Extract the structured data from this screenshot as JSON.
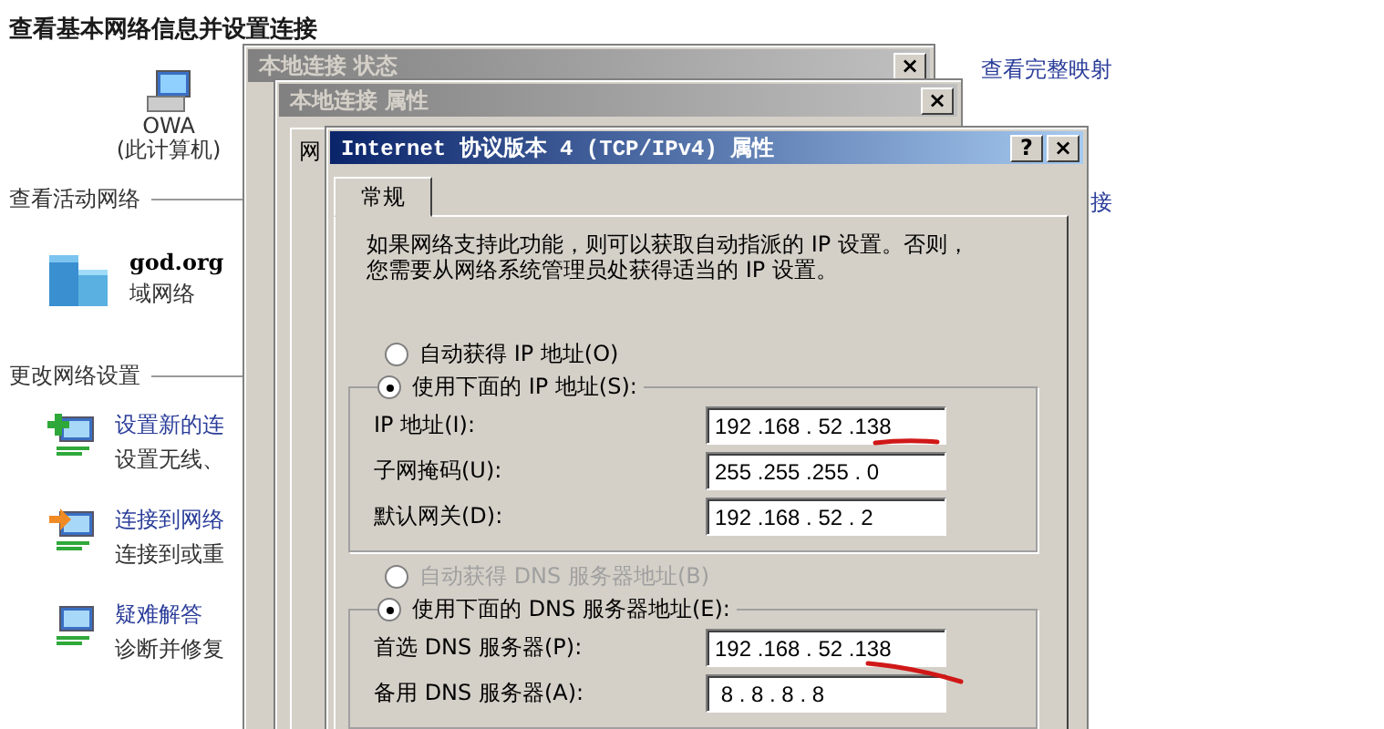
{
  "network_center": {
    "title": "查看基本网络信息并设置连接",
    "computer": {
      "name": "OWA",
      "label": "(此计算机)"
    },
    "active_networks": {
      "heading": "查看活动网络",
      "network": {
        "name": "god.org",
        "type": "域网络"
      }
    },
    "change_settings": {
      "heading": "更改网络设置",
      "tasks": [
        {
          "kind": "setup",
          "title": "设置新的连",
          "description": "设置无线、"
        },
        {
          "kind": "connect",
          "title": "连接到网络",
          "description": "连接到或重"
        },
        {
          "kind": "troubleshoot",
          "title": "疑难解答",
          "description": "诊断并修复"
        }
      ]
    },
    "links": [
      "查看完整映射",
      "接"
    ]
  },
  "status_window": {
    "title": "本地连接 状态",
    "active": false,
    "close": "×"
  },
  "properties_window": {
    "title": "本地连接 属性",
    "active": false,
    "close": "×",
    "tab": "网"
  },
  "ipv4_dialog": {
    "title": "Internet 协议版本 4 (TCP/IPv4) 属性",
    "active": true,
    "help": "?",
    "close": "×",
    "tabs": [
      {
        "label": "常规",
        "selected": true
      }
    ],
    "description_lines": [
      "如果网络支持此功能，则可以获取自动指派的 IP 设置。否则，",
      "您需要从网络系统管理员处获得适当的 IP 设置。"
    ],
    "ip_auto": {
      "label": "自动获得 IP 地址(O)",
      "selected": false,
      "disabled": false
    },
    "ip_manual": {
      "label": "使用下面的 IP 地址(S):",
      "selected": true,
      "disabled": false
    },
    "ip_fields": [
      {
        "label": "IP 地址(I):",
        "value": "192 .168 . 52 .138",
        "marked": true
      },
      {
        "label": "子网掩码(U):",
        "value": "255 .255 .255 . 0",
        "marked": false
      },
      {
        "label": "默认网关(D):",
        "value": "192 .168 . 52 . 2",
        "marked": false
      }
    ],
    "dns_auto": {
      "label": "自动获得 DNS 服务器地址(B)",
      "selected": false,
      "disabled": true
    },
    "dns_manual": {
      "label": "使用下面的 DNS 服务器地址(E):",
      "selected": true,
      "disabled": false
    },
    "dns_fields": [
      {
        "label": "首选 DNS 服务器(P):",
        "value": "192 .168 . 52 .138",
        "marked": true
      },
      {
        "label": "备用 DNS 服务器(A):",
        "value": " 8 . 8 . 8 . 8",
        "marked": false
      }
    ]
  }
}
